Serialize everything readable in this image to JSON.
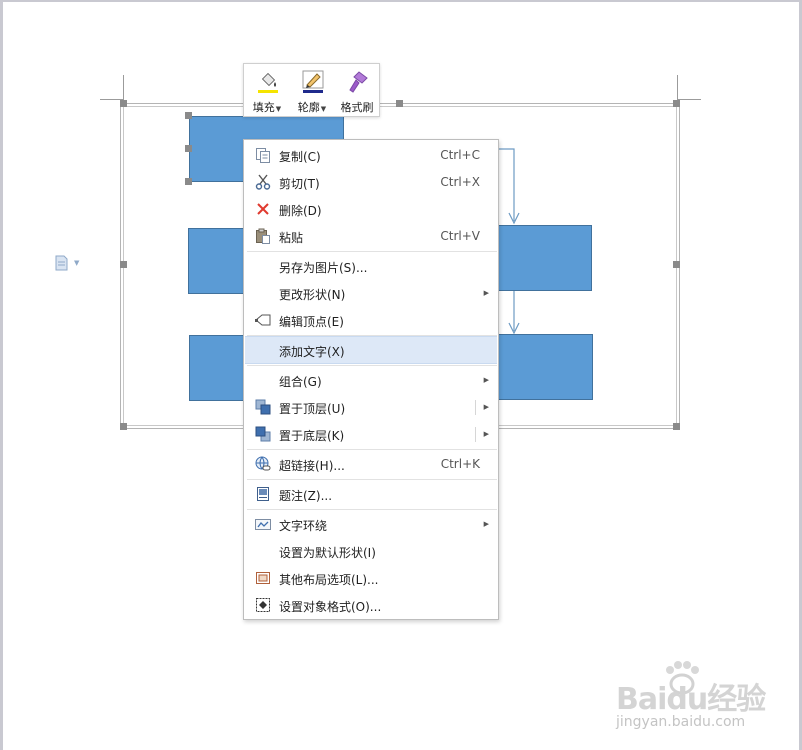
{
  "mini_toolbar": {
    "items": [
      {
        "label": "填充",
        "icon": "fill-bucket-icon",
        "accent": "#f5e400"
      },
      {
        "label": "轮廓",
        "icon": "outline-pencil-icon",
        "accent": "#1f2a8c"
      },
      {
        "label": "格式刷",
        "icon": "format-painter-icon",
        "accent": "#b27ad8"
      }
    ]
  },
  "context_menu": {
    "hover_color": "#dde8f7",
    "items": [
      {
        "label": "复制(C)",
        "shortcut": "Ctrl+C",
        "icon": "copy-icon"
      },
      {
        "label": "剪切(T)",
        "shortcut": "Ctrl+X",
        "icon": "scissors-icon"
      },
      {
        "label": "删除(D)",
        "shortcut": "",
        "icon": "delete-x-icon"
      },
      {
        "label": "粘贴",
        "shortcut": "Ctrl+V",
        "icon": "paste-icon"
      },
      {
        "label": "另存为图片(S)...",
        "shortcut": "",
        "icon": ""
      },
      {
        "label": "更改形状(N)",
        "shortcut": "",
        "icon": "",
        "submenu": true
      },
      {
        "label": "编辑顶点(E)",
        "shortcut": "",
        "icon": "edit-points-icon"
      },
      {
        "label": "添加文字(X)",
        "shortcut": "",
        "icon": "",
        "highlighted": true
      },
      {
        "label": "组合(G)",
        "shortcut": "",
        "icon": "",
        "submenu": true
      },
      {
        "label": "置于顶层(U)",
        "shortcut": "",
        "icon": "bring-to-front-icon",
        "submenu": true,
        "split": true
      },
      {
        "label": "置于底层(K)",
        "shortcut": "",
        "icon": "send-to-back-icon",
        "submenu": true,
        "split": true
      },
      {
        "label": "超链接(H)...",
        "shortcut": "Ctrl+K",
        "icon": "hyperlink-globe-icon"
      },
      {
        "label": "题注(Z)...",
        "shortcut": "",
        "icon": "caption-icon"
      },
      {
        "label": "文字环绕",
        "shortcut": "",
        "icon": "text-wrap-icon",
        "submenu": true
      },
      {
        "label": "设置为默认形状(I)",
        "shortcut": "",
        "icon": ""
      },
      {
        "label": "其他布局选项(L)...",
        "shortcut": "",
        "icon": "layout-options-icon"
      },
      {
        "label": "设置对象格式(O)...",
        "shortcut": "",
        "icon": "format-object-icon"
      }
    ]
  },
  "shape_color": "#5b9bd5",
  "watermark": {
    "main": "Baidu经验",
    "sub": "jingyan.baidu.com"
  }
}
